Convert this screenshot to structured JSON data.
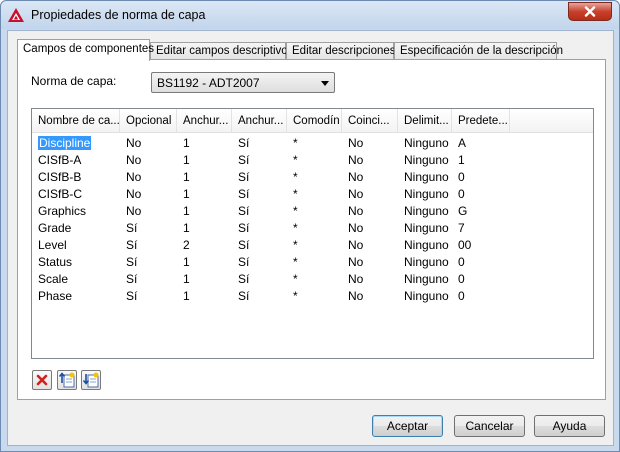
{
  "window": {
    "title": "Propiedades de norma de capa"
  },
  "tabs": [
    {
      "label": "Campos de componentes",
      "active": true
    },
    {
      "label": "Editar campos descriptivos",
      "active": false
    },
    {
      "label": "Editar descripciones",
      "active": false
    },
    {
      "label": "Especificación de la descripción",
      "active": false
    }
  ],
  "norma": {
    "label": "Norma de capa:",
    "value": "BS1192 - ADT2007"
  },
  "list": {
    "columns": [
      "Nombre de ca...",
      "Opcional",
      "Anchur...",
      "Anchur...",
      "Comodín",
      "Coinci...",
      "Delimit...",
      "Predete..."
    ],
    "rows": [
      [
        "Discipline",
        "No",
        "1",
        "Sí",
        "*",
        "No",
        "Ninguno",
        "A"
      ],
      [
        "CISfB-A",
        "No",
        "1",
        "Sí",
        "*",
        "No",
        "Ninguno",
        "1"
      ],
      [
        "CISfB-B",
        "No",
        "1",
        "Sí",
        "*",
        "No",
        "Ninguno",
        "0"
      ],
      [
        "CISfB-C",
        "No",
        "1",
        "Sí",
        "*",
        "No",
        "Ninguno",
        "0"
      ],
      [
        "Graphics",
        "No",
        "1",
        "Sí",
        "*",
        "No",
        "Ninguno",
        "G"
      ],
      [
        "Grade",
        "Sí",
        "1",
        "Sí",
        "*",
        "No",
        "Ninguno",
        "7"
      ],
      [
        "Level",
        "Sí",
        "2",
        "Sí",
        "*",
        "No",
        "Ninguno",
        "00"
      ],
      [
        "Status",
        "Sí",
        "1",
        "Sí",
        "*",
        "No",
        "Ninguno",
        "0"
      ],
      [
        "Scale",
        "Sí",
        "1",
        "Sí",
        "*",
        "No",
        "Ninguno",
        "0"
      ],
      [
        "Phase",
        "Sí",
        "1",
        "Sí",
        "*",
        "No",
        "Ninguno",
        "0"
      ]
    ],
    "selected_row": 0
  },
  "toolbar": {
    "icons": [
      "delete-icon",
      "move-up-icon",
      "move-down-icon"
    ]
  },
  "buttons": {
    "ok": "Aceptar",
    "cancel": "Cancelar",
    "help": "Ayuda"
  },
  "colors": {
    "selection": "#3399ff",
    "close": "#c8412c",
    "app_icon": "#c8102e"
  }
}
